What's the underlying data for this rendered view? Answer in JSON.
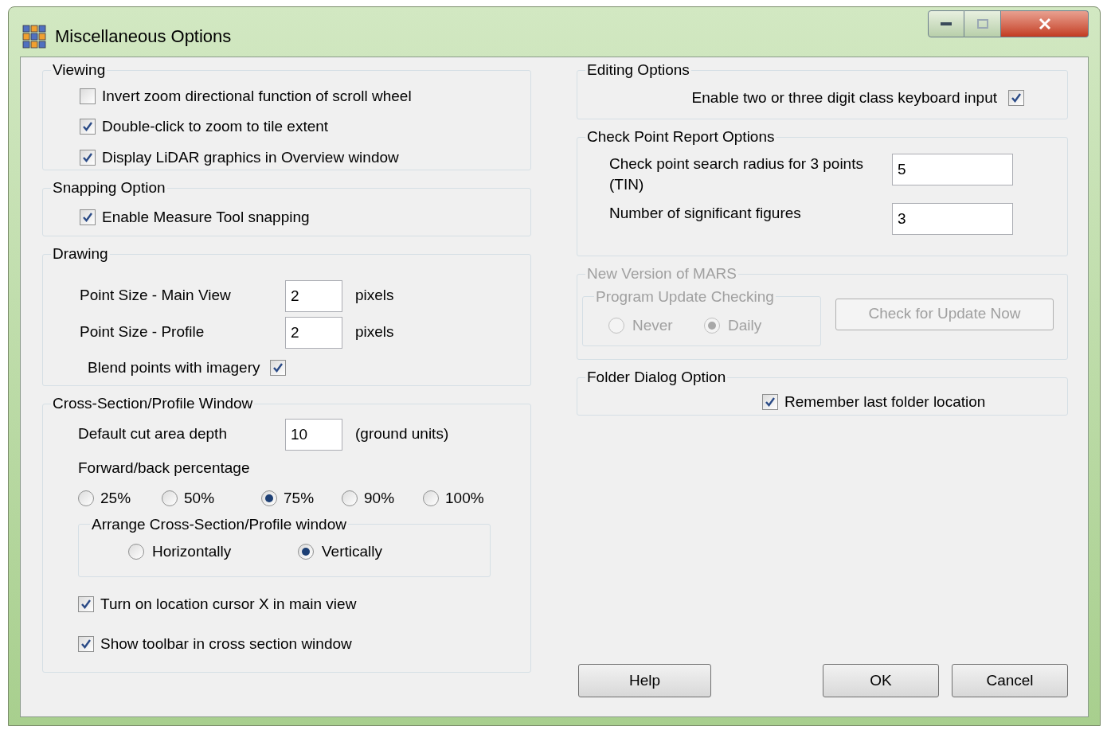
{
  "window": {
    "title": "Miscellaneous Options"
  },
  "viewing": {
    "title": "Viewing",
    "options": [
      {
        "label": "Invert zoom directional function of scroll wheel",
        "checked": false
      },
      {
        "label": "Double-click to zoom to tile extent",
        "checked": true
      },
      {
        "label": "Display LiDAR graphics in Overview window",
        "checked": true
      }
    ]
  },
  "snapping": {
    "title": "Snapping Option",
    "options": [
      {
        "label": "Enable Measure Tool snapping",
        "checked": true
      }
    ]
  },
  "drawing": {
    "title": "Drawing",
    "fields": [
      {
        "label": "Point Size - Main View",
        "value": "2",
        "unit": "pixels"
      },
      {
        "label": "Point Size - Profile",
        "value": "2",
        "unit": "pixels"
      }
    ],
    "blend": {
      "label": "Blend points with imagery",
      "checked": true
    }
  },
  "cross_section": {
    "title": "Cross-Section/Profile Window",
    "depth": {
      "label": "Default cut area depth",
      "value": "10",
      "unit": "(ground units)"
    },
    "percentage_label": "Forward/back percentage",
    "percentages": [
      {
        "label": "25%",
        "selected": false
      },
      {
        "label": "50%",
        "selected": false
      },
      {
        "label": "75%",
        "selected": true
      },
      {
        "label": "90%",
        "selected": false
      },
      {
        "label": "100%",
        "selected": false
      }
    ],
    "arrange": {
      "title": "Arrange Cross-Section/Profile window",
      "options": [
        {
          "label": "Horizontally",
          "selected": false
        },
        {
          "label": "Vertically",
          "selected": true
        }
      ]
    },
    "options": [
      {
        "label": "Turn on location cursor X in main view",
        "checked": true
      },
      {
        "label": "Show toolbar in cross section window",
        "checked": true
      }
    ]
  },
  "editing": {
    "title": "Editing Options",
    "option": {
      "label": "Enable two or three digit class keyboard input",
      "checked": true
    }
  },
  "check_point": {
    "title": "Check Point Report Options",
    "fields": [
      {
        "label": "Check point search radius for 3 points (TIN)",
        "value": "5"
      },
      {
        "label": "Number of significant figures",
        "value": "3"
      }
    ]
  },
  "new_version": {
    "title": "New Version of MARS",
    "disabled": true,
    "update": {
      "title": "Program Update Checking",
      "options": [
        {
          "label": "Never",
          "selected": false
        },
        {
          "label": "Daily",
          "selected": true
        }
      ]
    },
    "button": "Check for Update Now"
  },
  "folder": {
    "title": "Folder Dialog Option",
    "option": {
      "label": "Remember last folder location",
      "checked": true
    }
  },
  "buttons": [
    "Help",
    "OK",
    "Cancel"
  ]
}
